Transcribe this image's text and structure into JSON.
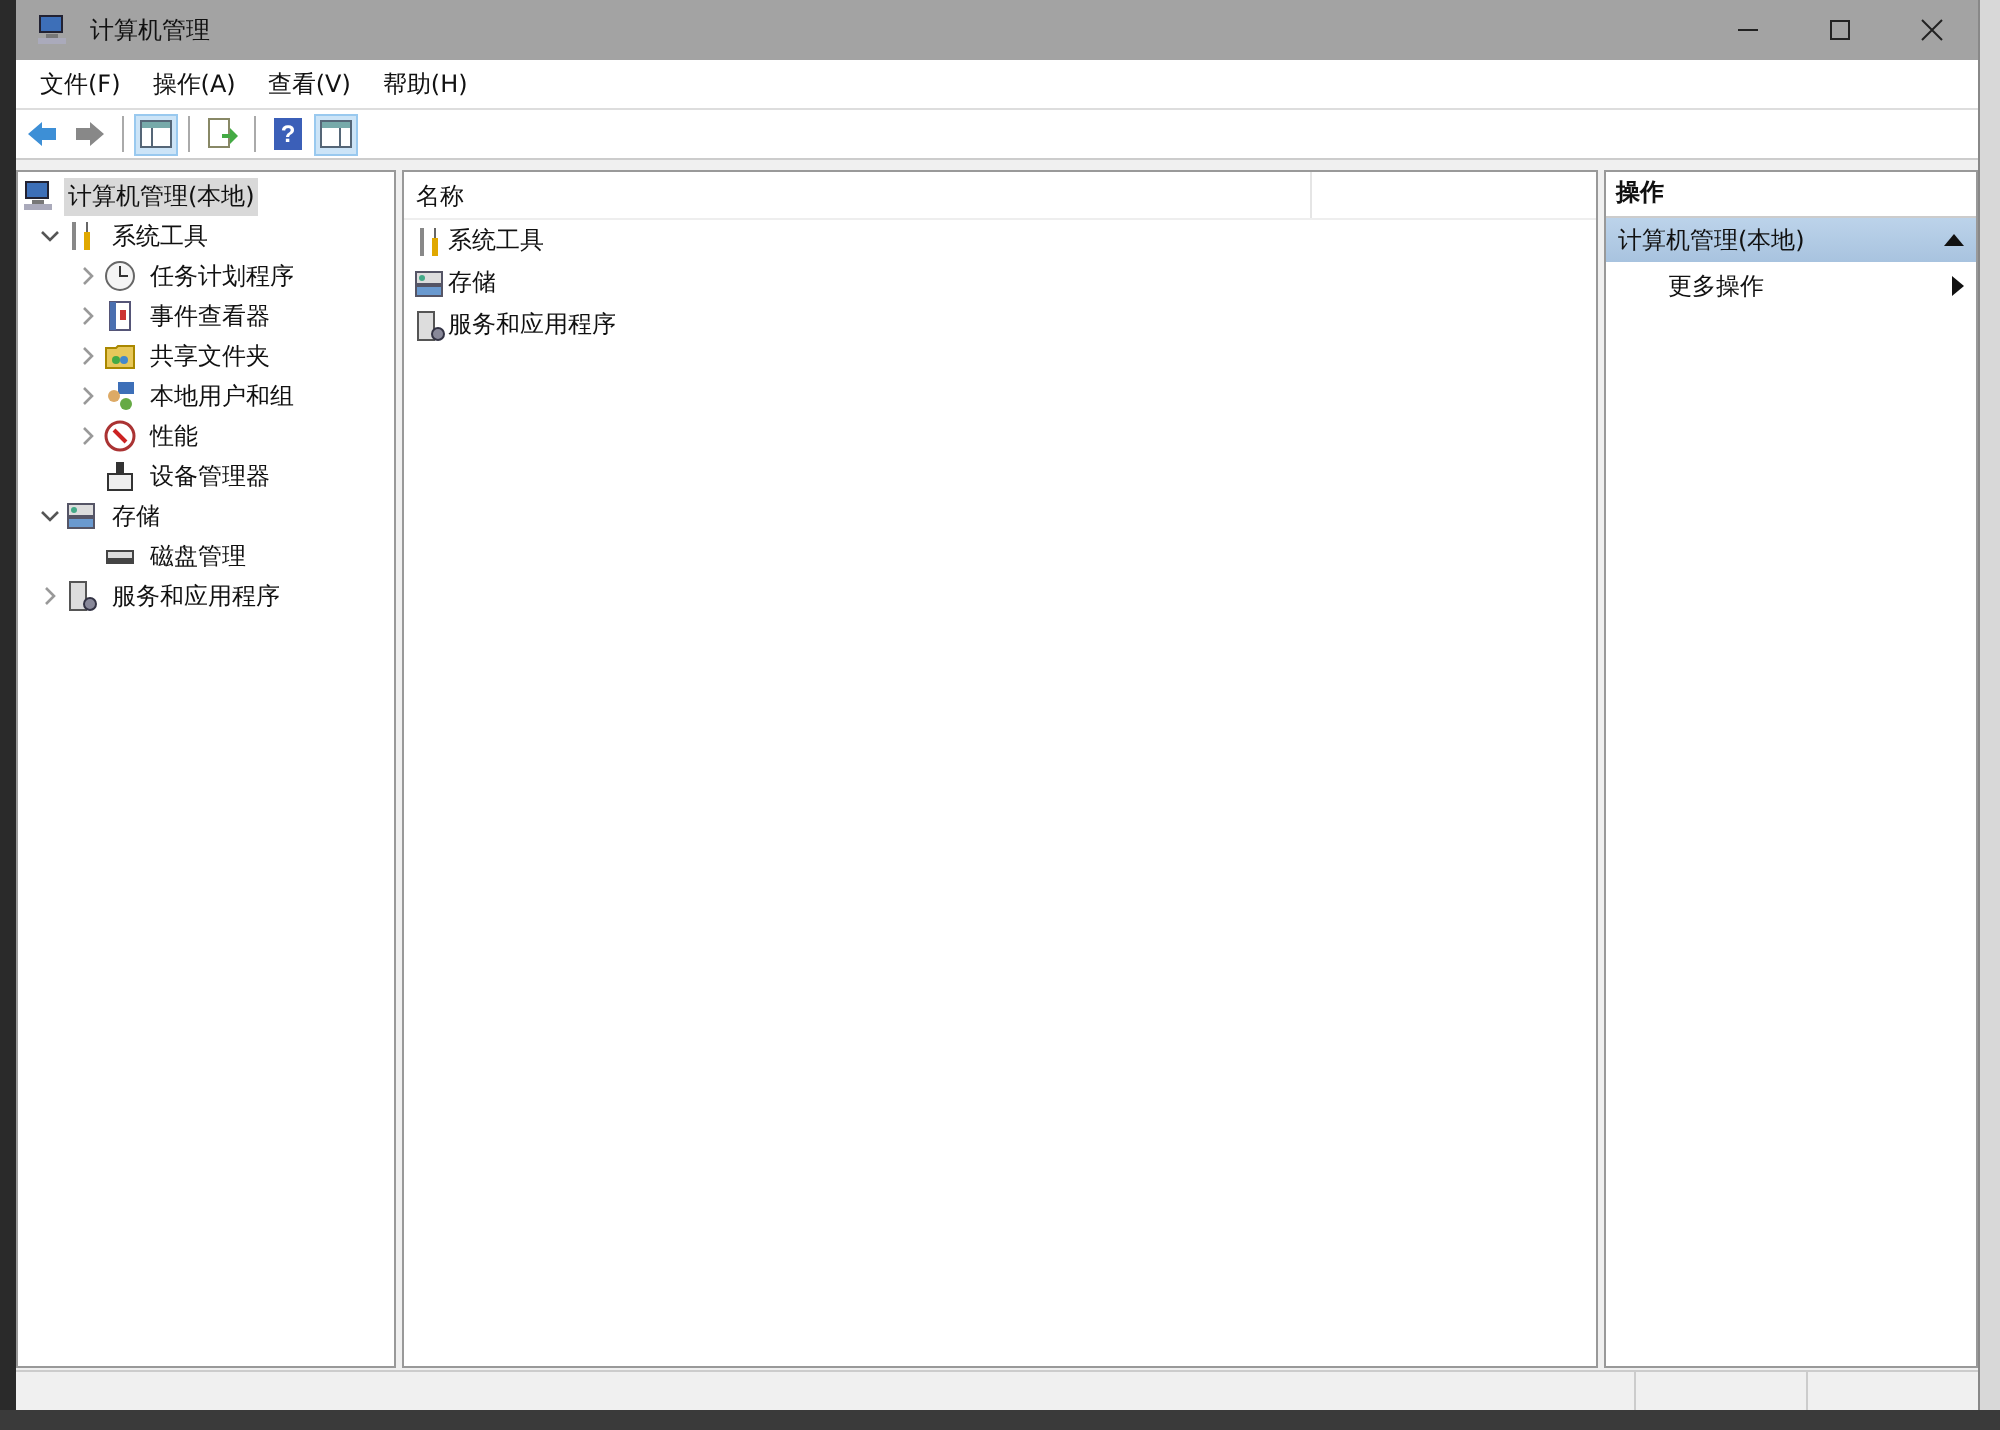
{
  "window": {
    "title": "计算机管理"
  },
  "menu": [
    "文件(F)",
    "操作(A)",
    "查看(V)",
    "帮助(H)"
  ],
  "toolbar": {
    "help_glyph": "?"
  },
  "tree": [
    {
      "label": "计算机管理(本地)",
      "selected": true,
      "kind": "root",
      "children": [
        {
          "label": "系统工具",
          "selected": false,
          "kind": "node",
          "expanded": true,
          "children": [
            {
              "label": "任务计划程序",
              "selected": false,
              "kind": "node",
              "expanded": false
            },
            {
              "label": "事件查看器",
              "selected": false,
              "kind": "node",
              "expanded": false
            },
            {
              "label": "共享文件夹",
              "selected": false,
              "kind": "node",
              "expanded": false
            },
            {
              "label": "本地用户和组",
              "selected": false,
              "kind": "node",
              "expanded": false
            },
            {
              "label": "性能",
              "selected": false,
              "kind": "node",
              "expanded": false
            },
            {
              "label": "设备管理器",
              "selected": false,
              "kind": "leaf"
            }
          ]
        },
        {
          "label": "存储",
          "selected": false,
          "kind": "node",
          "expanded": true,
          "children": [
            {
              "label": "磁盘管理",
              "selected": false,
              "kind": "leaf"
            }
          ]
        },
        {
          "label": "服务和应用程序",
          "selected": false,
          "kind": "node",
          "expanded": false
        }
      ]
    }
  ],
  "list": {
    "columns": [
      "名称"
    ],
    "rows": [
      "系统工具",
      "存储",
      "服务和应用程序"
    ]
  },
  "actions": {
    "header": "操作",
    "section": {
      "label": "计算机管理(本地)",
      "expanded": true
    },
    "items": [
      "更多操作"
    ]
  }
}
